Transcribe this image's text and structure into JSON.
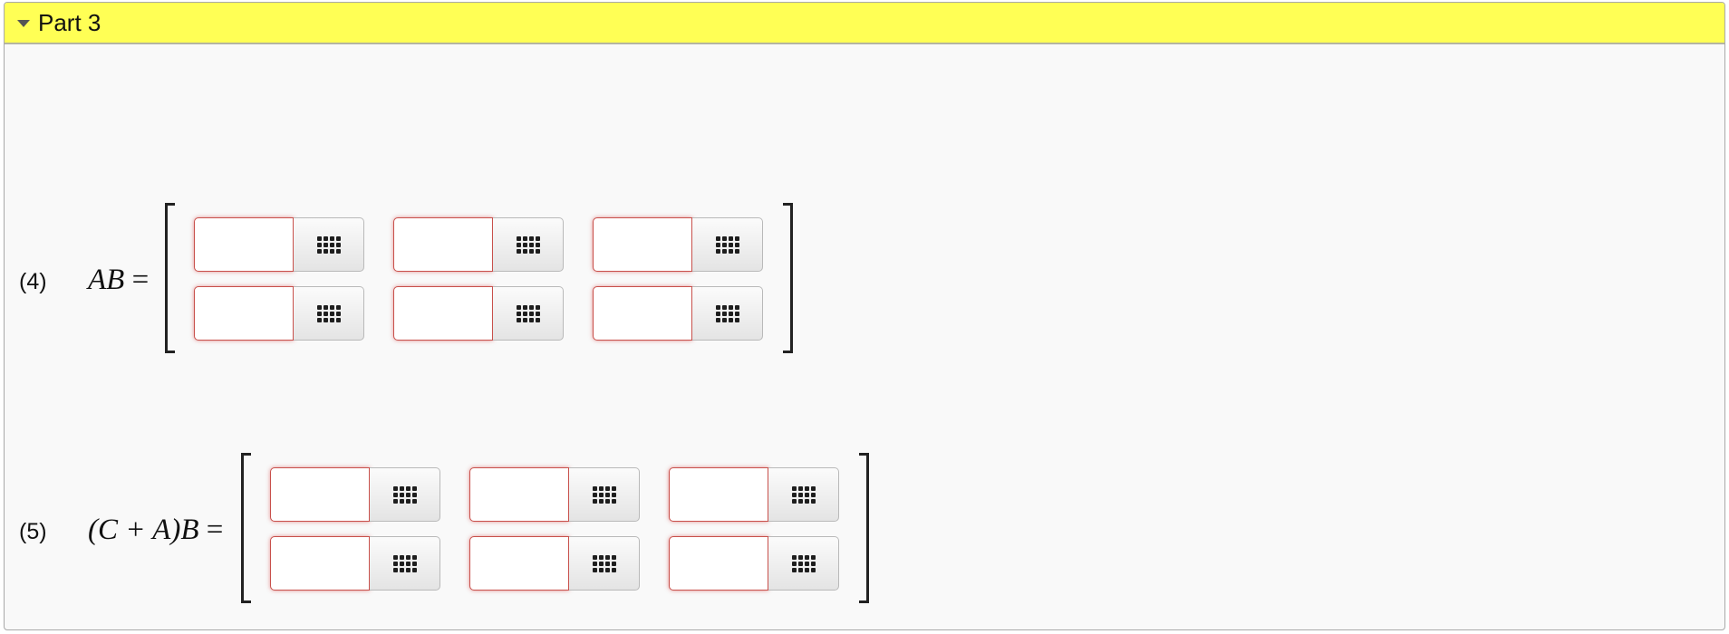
{
  "header": {
    "title": "Part 3",
    "background": "#ffff55"
  },
  "rows": [
    {
      "number": "(4)",
      "label": "AB",
      "rows": 2,
      "cols": 3,
      "cells": [
        [
          "",
          "",
          ""
        ],
        [
          "",
          "",
          ""
        ]
      ]
    },
    {
      "number": "(5)",
      "label": "(C + A)B",
      "rows": 2,
      "cols": 3,
      "cells": [
        [
          "",
          "",
          ""
        ],
        [
          "",
          "",
          ""
        ]
      ]
    }
  ],
  "equals_sign": "=",
  "palette_icon": "grid-icon"
}
